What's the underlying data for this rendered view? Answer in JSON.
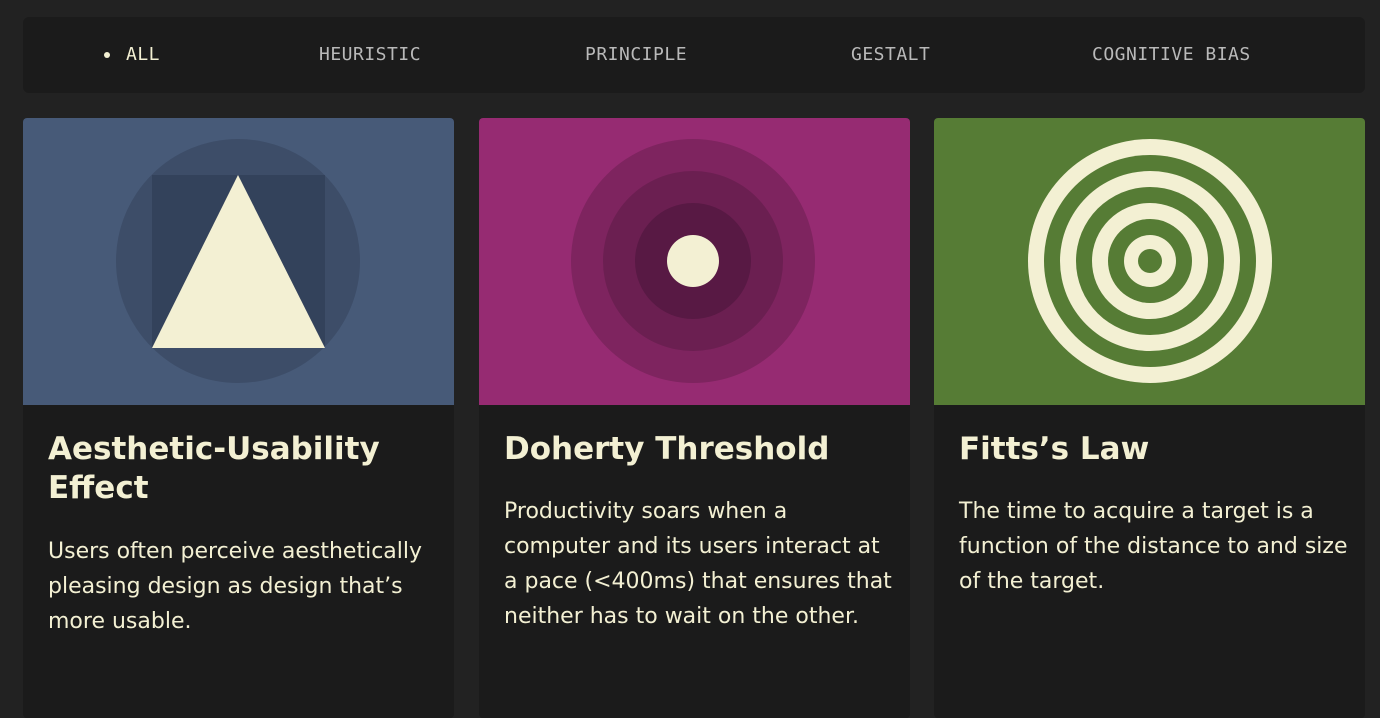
{
  "filters": {
    "items": [
      {
        "label": "ALL",
        "active": true
      },
      {
        "label": "HEURISTIC",
        "active": false
      },
      {
        "label": "PRINCIPLE",
        "active": false
      },
      {
        "label": "GESTALT",
        "active": false
      },
      {
        "label": "COGNITIVE BIAS",
        "active": false
      }
    ]
  },
  "cards": [
    {
      "title": "Aesthetic-Usability Effect",
      "description": "Users often perceive aesthetically pleasing design as design that’s more usable.",
      "icon": "triangle-in-circle-icon",
      "bg_color": "#475a78"
    },
    {
      "title": "Doherty Threshold",
      "description": "Productivity soars when a computer and its users interact at a pace (<400ms) that ensures that neither has to wait on the other.",
      "icon": "concentric-circles-icon",
      "bg_color": "#962b72"
    },
    {
      "title": "Fitts’s Law",
      "description": "The time to acquire a target is a function of the distance to and size of the target.",
      "icon": "target-icon",
      "bg_color": "#567c35"
    }
  ],
  "colors": {
    "page_bg": "#222222",
    "panel_bg": "#1b1b1b",
    "cream": "#f3f0d3",
    "muted_text": "#b9b9b9"
  }
}
